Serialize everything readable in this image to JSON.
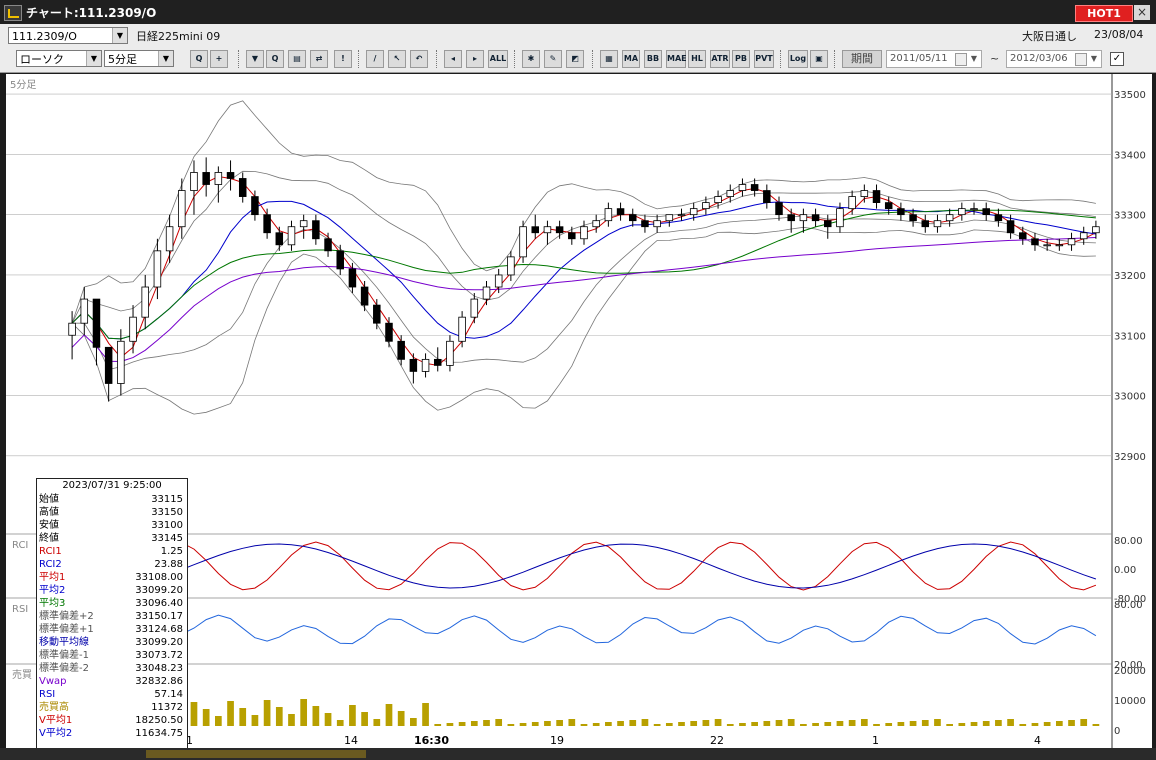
{
  "window": {
    "title": "チャート:111.2309/O",
    "hot_label": "HOT1",
    "close_label": "×",
    "app_icon": "chart-app-icon"
  },
  "toolbar1": {
    "symbol_value": "111.2309/O",
    "instrument_name": "日経225mini 09",
    "session": "大阪日通し",
    "date": "23/08/04"
  },
  "toolbar2": {
    "chart_type": "ローソク",
    "interval": "5分足",
    "buttons": [
      {
        "name": "zoom-icon",
        "label": "Q"
      },
      {
        "name": "crosshair-icon",
        "label": "+"
      },
      {
        "name": "candle-add-icon",
        "label": "▼"
      },
      {
        "name": "magnify-icon",
        "label": "Q"
      },
      {
        "name": "chart-icon",
        "label": "▤"
      },
      {
        "name": "compare-icon",
        "label": "⇄"
      },
      {
        "name": "alert-icon",
        "label": "!"
      },
      {
        "name": "pen-icon",
        "label": "/"
      },
      {
        "name": "cursor-icon",
        "label": "↖"
      },
      {
        "name": "undo-icon",
        "label": "↶"
      },
      {
        "name": "left-icon",
        "label": "◂"
      },
      {
        "name": "right-icon",
        "label": "▸"
      },
      {
        "name": "all-icon",
        "label": "ALL"
      },
      {
        "name": "settings-icon",
        "label": "✱"
      },
      {
        "name": "tool-icon",
        "label": "✎"
      },
      {
        "name": "color-icon",
        "label": "◩"
      },
      {
        "name": "grid-icon",
        "label": "▦"
      },
      {
        "name": "ma-icon",
        "label": "MA"
      },
      {
        "name": "bb-icon",
        "label": "BB"
      },
      {
        "name": "mae-icon",
        "label": "MAE"
      },
      {
        "name": "hl-icon",
        "label": "HL"
      },
      {
        "name": "atr-icon",
        "label": "ATR"
      },
      {
        "name": "pb-icon",
        "label": "PB"
      },
      {
        "name": "pvt-icon",
        "label": "PVT"
      },
      {
        "name": "log-icon",
        "label": "Log"
      },
      {
        "name": "export-icon",
        "label": "▣"
      }
    ],
    "period_label": "期間",
    "date_from": "2011/05/11",
    "tilde": "~",
    "date_to": "2012/03/06",
    "checkbox_mark": "✓"
  },
  "chart_data": {
    "type": "candlestick",
    "interval_label": "5分足",
    "price_axis": {
      "min": 32850,
      "max": 33520,
      "ticks": [
        33500,
        33400,
        33300,
        33200,
        33100,
        33000,
        32900
      ]
    },
    "x_labels": [
      "1",
      "14",
      "16:30",
      "19",
      "22",
      "1",
      "4"
    ],
    "candles": [
      [
        33100,
        33140,
        33060,
        33120
      ],
      [
        33120,
        33180,
        33100,
        33160
      ],
      [
        33160,
        33120,
        33050,
        33080
      ],
      [
        33080,
        33020,
        32990,
        33020
      ],
      [
        33020,
        33110,
        33000,
        33090
      ],
      [
        33090,
        33150,
        33070,
        33130
      ],
      [
        33130,
        33200,
        33110,
        33180
      ],
      [
        33180,
        33260,
        33160,
        33240
      ],
      [
        33240,
        33300,
        33220,
        33280
      ],
      [
        33280,
        33360,
        33260,
        33340
      ],
      [
        33340,
        33390,
        33300,
        33370
      ],
      [
        33370,
        33395,
        33330,
        33350
      ],
      [
        33350,
        33380,
        33320,
        33370
      ],
      [
        33370,
        33390,
        33340,
        33360
      ],
      [
        33360,
        33370,
        33320,
        33330
      ],
      [
        33330,
        33340,
        33290,
        33300
      ],
      [
        33300,
        33310,
        33260,
        33270
      ],
      [
        33270,
        33280,
        33240,
        33250
      ],
      [
        33250,
        33290,
        33240,
        33280
      ],
      [
        33280,
        33300,
        33260,
        33290
      ],
      [
        33290,
        33300,
        33250,
        33260
      ],
      [
        33260,
        33270,
        33230,
        33240
      ],
      [
        33240,
        33250,
        33200,
        33210
      ],
      [
        33210,
        33220,
        33170,
        33180
      ],
      [
        33180,
        33190,
        33140,
        33150
      ],
      [
        33150,
        33160,
        33110,
        33120
      ],
      [
        33120,
        33130,
        33080,
        33090
      ],
      [
        33090,
        33100,
        33050,
        33060
      ],
      [
        33060,
        33070,
        33020,
        33040
      ],
      [
        33040,
        33070,
        33030,
        33060
      ],
      [
        33060,
        33080,
        33040,
        33050
      ],
      [
        33050,
        33100,
        33040,
        33090
      ],
      [
        33090,
        33140,
        33080,
        33130
      ],
      [
        33130,
        33170,
        33120,
        33160
      ],
      [
        33160,
        33190,
        33150,
        33180
      ],
      [
        33180,
        33210,
        33170,
        33200
      ],
      [
        33200,
        33240,
        33190,
        33230
      ],
      [
        33230,
        33290,
        33220,
        33280
      ],
      [
        33280,
        33300,
        33260,
        33270
      ],
      [
        33270,
        33290,
        33250,
        33280
      ],
      [
        33280,
        33290,
        33260,
        33270
      ],
      [
        33270,
        33280,
        33250,
        33260
      ],
      [
        33260,
        33290,
        33250,
        33280
      ],
      [
        33280,
        33300,
        33270,
        33290
      ],
      [
        33290,
        33320,
        33280,
        33310
      ],
      [
        33310,
        33320,
        33290,
        33300
      ],
      [
        33300,
        33310,
        33280,
        33290
      ],
      [
        33290,
        33300,
        33270,
        33280
      ],
      [
        33280,
        33300,
        33270,
        33290
      ],
      [
        33290,
        33300,
        33280,
        33300
      ],
      [
        33300,
        33310,
        33290,
        33300
      ],
      [
        33300,
        33320,
        33290,
        33310
      ],
      [
        33310,
        33330,
        33300,
        33320
      ],
      [
        33320,
        33340,
        33310,
        33330
      ],
      [
        33330,
        33350,
        33320,
        33340
      ],
      [
        33340,
        33360,
        33330,
        33350
      ],
      [
        33350,
        33360,
        33330,
        33340
      ],
      [
        33340,
        33350,
        33310,
        33320
      ],
      [
        33320,
        33330,
        33290,
        33300
      ],
      [
        33300,
        33310,
        33270,
        33290
      ],
      [
        33290,
        33310,
        33270,
        33300
      ],
      [
        33300,
        33310,
        33280,
        33290
      ],
      [
        33290,
        33300,
        33260,
        33280
      ],
      [
        33280,
        33320,
        33270,
        33310
      ],
      [
        33310,
        33340,
        33300,
        33330
      ],
      [
        33330,
        33350,
        33320,
        33340
      ],
      [
        33340,
        33350,
        33310,
        33320
      ],
      [
        33320,
        33330,
        33300,
        33310
      ],
      [
        33310,
        33320,
        33290,
        33300
      ],
      [
        33300,
        33310,
        33280,
        33290
      ],
      [
        33290,
        33300,
        33270,
        33280
      ],
      [
        33280,
        33300,
        33270,
        33290
      ],
      [
        33290,
        33310,
        33280,
        33300
      ],
      [
        33300,
        33320,
        33290,
        33310
      ],
      [
        33310,
        33320,
        33300,
        33310
      ],
      [
        33310,
        33320,
        33290,
        33300
      ],
      [
        33300,
        33310,
        33280,
        33290
      ],
      [
        33290,
        33300,
        33260,
        33270
      ],
      [
        33270,
        33280,
        33250,
        33260
      ],
      [
        33260,
        33270,
        33240,
        33250
      ],
      [
        33250,
        33260,
        33240,
        33250
      ],
      [
        33250,
        33260,
        33240,
        33250
      ],
      [
        33250,
        33270,
        33240,
        33260
      ],
      [
        33260,
        33280,
        33250,
        33270
      ],
      [
        33270,
        33290,
        33260,
        33280
      ]
    ],
    "series_colors": {
      "ma1": "#cc0000",
      "ma2": "#0000cc",
      "ma3": "#007700",
      "vwap": "#7700cc",
      "bb": "#777777"
    },
    "rci": {
      "label": "RCI",
      "ticks": [
        "80.00",
        "0.00",
        "-80.00"
      ]
    },
    "rsi": {
      "label": "RSI",
      "ticks": [
        "80.00",
        "20.00"
      ]
    },
    "volume": {
      "label": "売買",
      "ticks": [
        "20000",
        "10000",
        "0"
      ]
    }
  },
  "panel": {
    "timestamp": "2023/07/31  9:25:00",
    "rows": [
      {
        "label": "始値",
        "value": "33115",
        "color": "#000000"
      },
      {
        "label": "高値",
        "value": "33150",
        "color": "#000000"
      },
      {
        "label": "安値",
        "value": "33100",
        "color": "#000000"
      },
      {
        "label": "終値",
        "value": "33145",
        "color": "#000000"
      },
      {
        "label": "RCI1",
        "value": "1.25",
        "color": "#cc0000"
      },
      {
        "label": "RCI2",
        "value": "23.88",
        "color": "#0000cc"
      },
      {
        "label": "平均1",
        "value": "33108.00",
        "color": "#cc0000"
      },
      {
        "label": "平均2",
        "value": "33099.20",
        "color": "#0000cc"
      },
      {
        "label": "平均3",
        "value": "33096.40",
        "color": "#007700"
      },
      {
        "label": "標準偏差+2",
        "value": "33150.17",
        "color": "#555555"
      },
      {
        "label": "標準偏差+1",
        "value": "33124.68",
        "color": "#555555"
      },
      {
        "label": "移動平均線",
        "value": "33099.20",
        "color": "#0000aa"
      },
      {
        "label": "標準偏差-1",
        "value": "33073.72",
        "color": "#555555"
      },
      {
        "label": "標準偏差-2",
        "value": "33048.23",
        "color": "#555555"
      },
      {
        "label": "Vwap",
        "value": "32832.86",
        "color": "#7700cc"
      },
      {
        "label": "RSI",
        "value": "57.14",
        "color": "#0000cc"
      },
      {
        "label": "売買高",
        "value": "11372",
        "color": "#aa8800"
      },
      {
        "label": "V平均1",
        "value": "18250.50",
        "color": "#cc0000"
      },
      {
        "label": "V平均2",
        "value": "11634.75",
        "color": "#0000cc"
      }
    ]
  }
}
